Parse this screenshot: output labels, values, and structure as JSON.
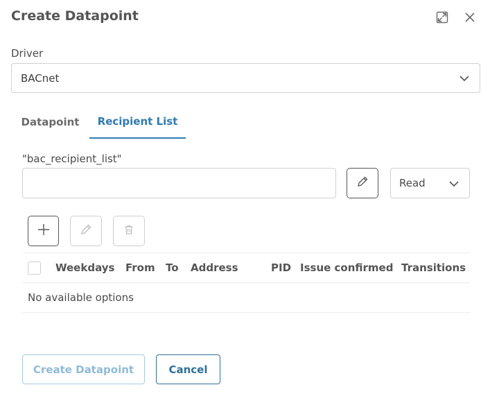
{
  "dialog": {
    "title": "Create Datapoint"
  },
  "driver": {
    "label": "Driver",
    "value": "BACnet"
  },
  "tabs": [
    {
      "label": "Datapoint",
      "active": false
    },
    {
      "label": "Recipient List",
      "active": true
    }
  ],
  "recipient_list": {
    "field_label": "\"bac_recipient_list\"",
    "value": "",
    "placeholder": "",
    "mode": "Read"
  },
  "table": {
    "columns": [
      "Weekdays",
      "From",
      "To",
      "Address",
      "PID",
      "Issue confirmed",
      "Transitions"
    ],
    "empty_text": "No available options"
  },
  "footer": {
    "create_label": "Create Datapoint",
    "cancel_label": "Cancel"
  },
  "colors": {
    "accent": "#2f7bb0",
    "disabled_accent": "#8fbbd8",
    "text": "#3b3b3b"
  },
  "icons": {
    "expand": "expand-icon",
    "close": "close-icon",
    "chevron": "chevron-down-icon",
    "edit": "pencil-icon",
    "add": "plus-icon",
    "delete": "trash-icon"
  }
}
